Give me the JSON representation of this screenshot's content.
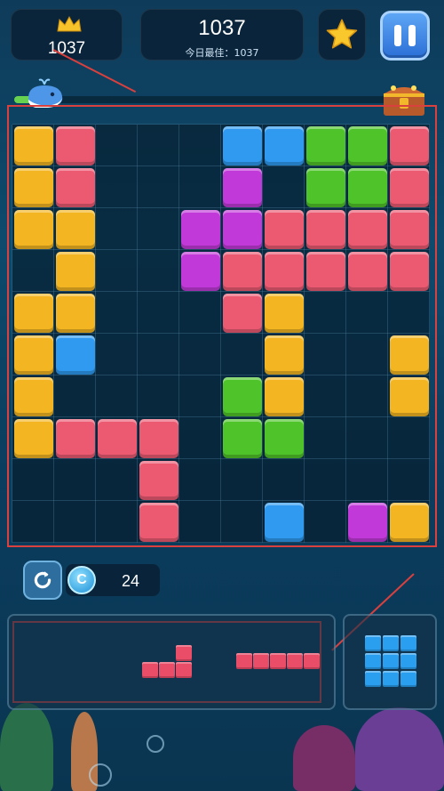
{
  "header": {
    "best_score": "1037",
    "current_score": "1037",
    "today_best": "今日最佳：1037"
  },
  "progress": {
    "fraction": 0.12
  },
  "board": {
    "rows": 10,
    "cols": 10,
    "colors": {
      "Y": "#f3b622",
      "R": "#ec5a72",
      "B": "#2f9af0",
      "G": "#4fc42a",
      "M": "#c13ad9"
    },
    "cells": [
      "YR...BBGGR",
      "YR...M.GGR",
      "YY..MMRRRR",
      ".Y..MRRRRR",
      "YY...RY...",
      "YB....Y..Y",
      "Y....GY..Y",
      "YRRR.GG...",
      "...R......",
      "...R..B.MY"
    ]
  },
  "refresh": {
    "count": "24",
    "coin_symbol": "C"
  },
  "tray": {
    "piece1": "L-shape (3 red)",
    "piece2": "I-5 (red)",
    "hold": "3x3 blue"
  }
}
